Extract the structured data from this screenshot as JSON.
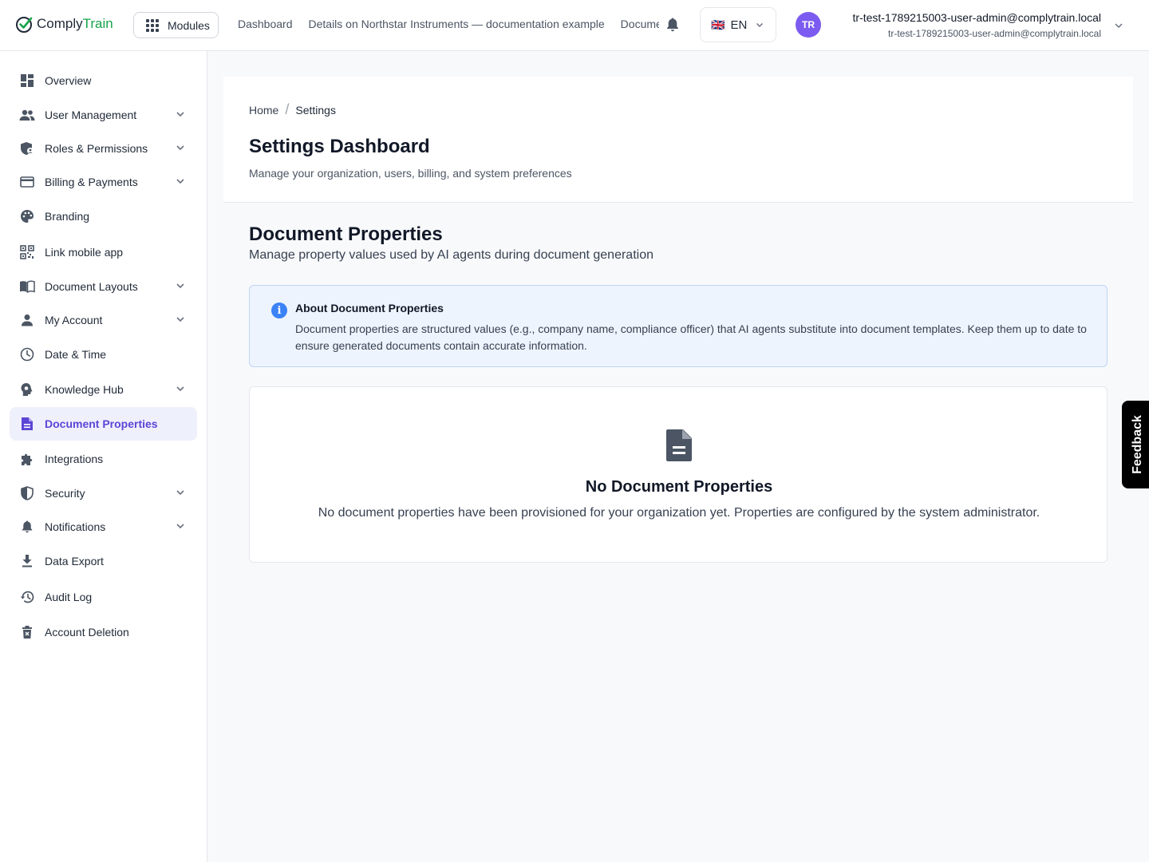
{
  "app": {
    "logo_part1": "Comply",
    "logo_part2": "Train",
    "brand_color": "#16a34a",
    "accent_color": "#5b45d6"
  },
  "topbar": {
    "modules_label": "Modules",
    "nav": [
      "Dashboard",
      "Details on Northstar Instruments — documentation example",
      "Documents"
    ],
    "language": "EN",
    "language_flag": "🇬🇧",
    "avatar_initials": "TR",
    "user_name": "tr-test-1789215003-user-admin@complytrain.local",
    "user_email": "tr-test-1789215003-user-admin@complytrain.local"
  },
  "sidebar": {
    "items": [
      {
        "label": "Overview",
        "icon": "dashboard-icon",
        "expandable": false
      },
      {
        "label": "User Management",
        "icon": "users-icon",
        "expandable": true
      },
      {
        "label": "Roles & Permissions",
        "icon": "shield-user-icon",
        "expandable": true
      },
      {
        "label": "Billing & Payments",
        "icon": "credit-card-icon",
        "expandable": true
      },
      {
        "label": "Branding",
        "icon": "palette-icon",
        "expandable": false
      },
      {
        "label": "Link mobile app",
        "icon": "qr-code-icon",
        "expandable": false
      },
      {
        "label": "Document Layouts",
        "icon": "book-icon",
        "expandable": true
      },
      {
        "label": "My Account",
        "icon": "person-icon",
        "expandable": true
      },
      {
        "label": "Date & Time",
        "icon": "clock-icon",
        "expandable": false
      },
      {
        "label": "Knowledge Hub",
        "icon": "brain-icon",
        "expandable": true
      },
      {
        "label": "Document Properties",
        "icon": "document-icon",
        "expandable": false,
        "active": true
      },
      {
        "label": "Integrations",
        "icon": "puzzle-icon",
        "expandable": false
      },
      {
        "label": "Security",
        "icon": "security-icon",
        "expandable": true
      },
      {
        "label": "Notifications",
        "icon": "bell-icon",
        "expandable": true
      },
      {
        "label": "Data Export",
        "icon": "download-icon",
        "expandable": false
      },
      {
        "label": "Audit Log",
        "icon": "history-icon",
        "expandable": false
      },
      {
        "label": "Account Deletion",
        "icon": "trash-icon",
        "expandable": false
      }
    ]
  },
  "header": {
    "breadcrumb": [
      "Home",
      "Settings"
    ],
    "title": "Settings Dashboard",
    "subtitle": "Manage your organization, users, billing, and system preferences"
  },
  "section": {
    "title": "Document Properties",
    "subtitle": "Manage property values used by AI agents during document generation"
  },
  "info": {
    "title": "About Document Properties",
    "text": "Document properties are structured values (e.g., company name, compliance officer) that AI agents substitute into document templates. Keep them up to date to ensure generated documents contain accurate information."
  },
  "empty_state": {
    "title": "No Document Properties",
    "text": "No document properties have been provisioned for your organization yet. Properties are configured by the system administrator."
  },
  "feedback": {
    "label": "Feedback"
  }
}
